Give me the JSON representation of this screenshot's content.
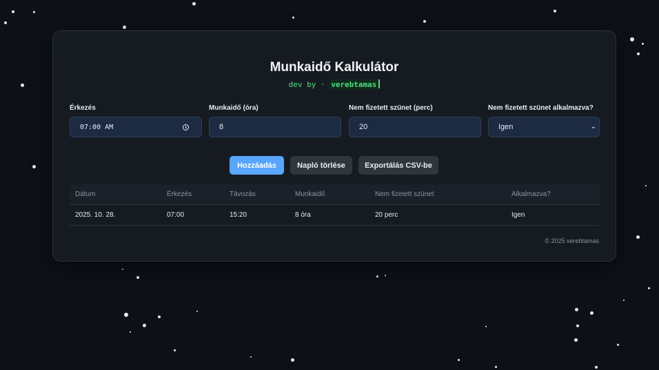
{
  "app": {
    "title": "Munkaidő Kalkulátor",
    "subtitle_prefix": "dev by · ",
    "author": "verebtamas"
  },
  "form": {
    "arrival": {
      "label": "Érkezés",
      "value": "07:00 AM"
    },
    "hours": {
      "label": "Munkaidő (óra)",
      "value": "8"
    },
    "break": {
      "label": "Nem fizetett szünet (perc)",
      "value": "20"
    },
    "apply": {
      "label": "Nem fizetett szünet alkalmazva?",
      "value": "Igen"
    }
  },
  "buttons": {
    "add": "Hozzáadás",
    "clear": "Napló törlése",
    "export": "Exportálás CSV-be"
  },
  "table": {
    "headers": [
      "Dátum",
      "Érkezés",
      "Távozás",
      "Munkaidő",
      "Nem fizetett szünet",
      "Alkalmazva?"
    ],
    "rows": [
      [
        "2025. 10. 28.",
        "07:00",
        "15:20",
        "8 óra",
        "20 perc",
        "Igen"
      ]
    ]
  },
  "footer": "© 2025 verebtamas",
  "colors": {
    "background": "#0d1117",
    "card": "#161b22",
    "accent": "#58a6ff",
    "terminal_green": "#4ade80"
  }
}
